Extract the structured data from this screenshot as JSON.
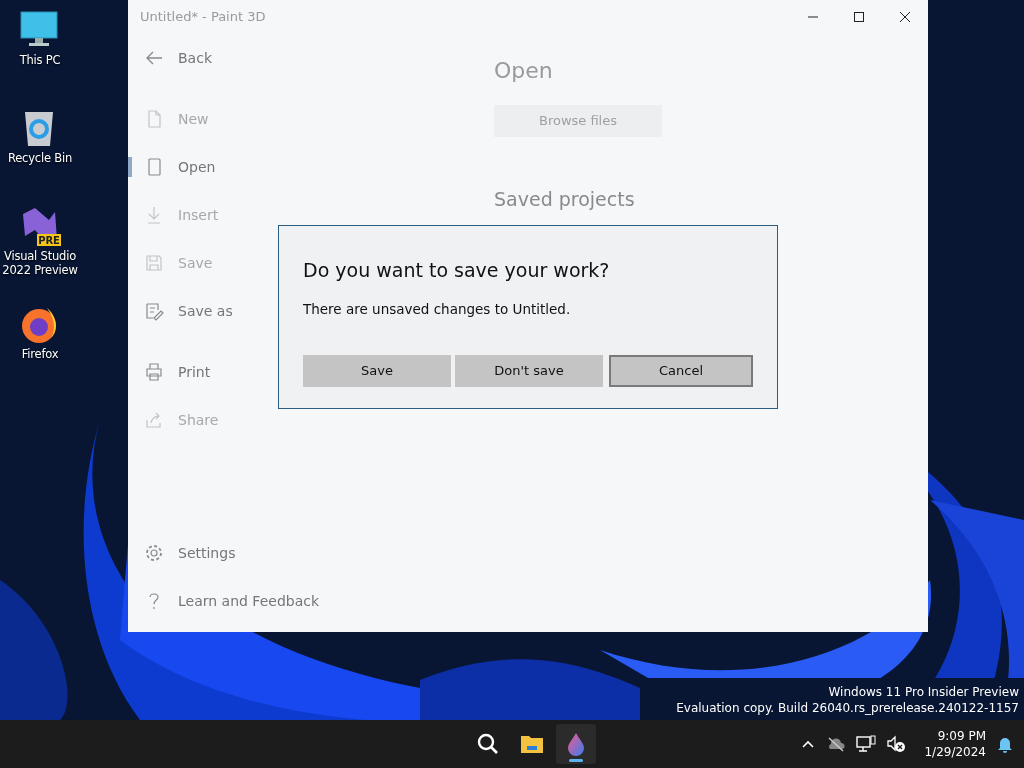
{
  "desktop_icons": [
    {
      "label": "This PC",
      "kind": "pc"
    },
    {
      "label": "Recycle Bin",
      "kind": "bin"
    },
    {
      "label": "Visual Studio 2022 Preview",
      "kind": "vs",
      "badge": "PRE"
    },
    {
      "label": "Firefox",
      "kind": "firefox"
    }
  ],
  "window": {
    "title": "Untitled* - Paint 3D"
  },
  "sidebar": {
    "back": "Back",
    "sections": [
      {
        "items": [
          {
            "label": "New",
            "kind": "page",
            "disabled": true,
            "selected": false
          },
          {
            "label": "Open",
            "kind": "folder",
            "disabled": false,
            "selected": true
          },
          {
            "label": "Insert",
            "kind": "download",
            "disabled": true,
            "selected": false
          },
          {
            "label": "Save",
            "kind": "disk",
            "disabled": true,
            "selected": false
          },
          {
            "label": "Save as",
            "kind": "saveas",
            "disabled": false,
            "selected": false
          }
        ]
      },
      {
        "items": [
          {
            "label": "Print",
            "kind": "printer",
            "disabled": false,
            "selected": false
          },
          {
            "label": "Share",
            "kind": "share",
            "disabled": true,
            "selected": false
          }
        ]
      }
    ],
    "footer": [
      {
        "label": "Settings",
        "kind": "gear"
      },
      {
        "label": "Learn and Feedback",
        "kind": "question"
      }
    ]
  },
  "content": {
    "heading": "Open",
    "browse_button": "Browse files",
    "section": "Saved projects"
  },
  "dialog": {
    "title": "Do you want to save your work?",
    "message": "There are unsaved changes to Untitled.",
    "buttons": [
      {
        "label": "Save",
        "focused": false
      },
      {
        "label": "Don't save",
        "focused": false
      },
      {
        "label": "Cancel",
        "focused": true
      }
    ]
  },
  "watermark": [
    "Windows 11 Pro Insider Preview",
    "Evaluation copy. Build 26040.rs_prerelease.240122-1157"
  ],
  "taskbar": {
    "apps": [
      {
        "kind": "search",
        "active": false
      },
      {
        "kind": "explorer",
        "active": false
      },
      {
        "kind": "paint3d",
        "active": true
      }
    ],
    "time": "9:09 PM",
    "date": "1/29/2024"
  }
}
